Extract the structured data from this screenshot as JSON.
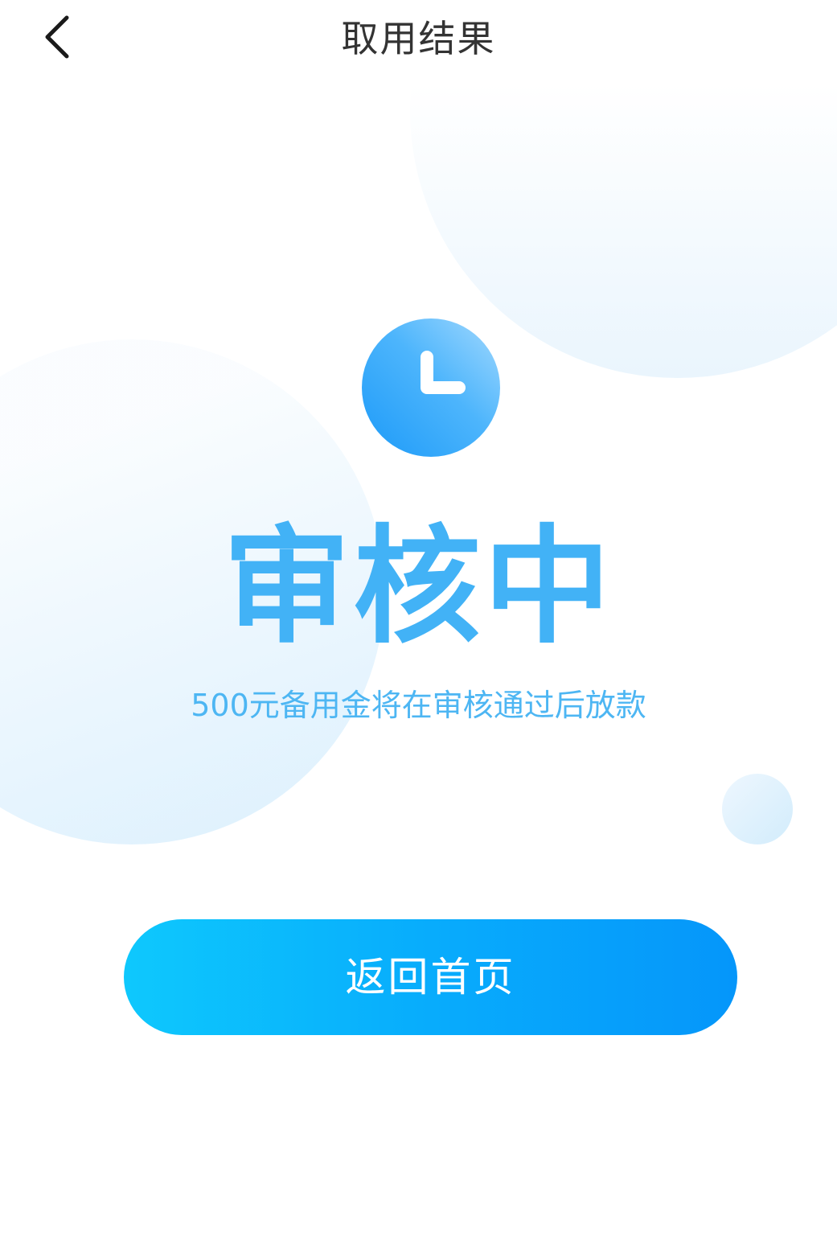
{
  "header": {
    "title": "取用结果",
    "back_icon": "chevron-left-icon"
  },
  "status": {
    "icon": "clock-icon",
    "title": "审核中",
    "description": "500元备用金将在审核通过后放款"
  },
  "actions": {
    "home_label": "返回首页"
  },
  "colors": {
    "primary": "#0AAEFC",
    "status_text": "#42B2F6",
    "title_text": "#333333"
  }
}
